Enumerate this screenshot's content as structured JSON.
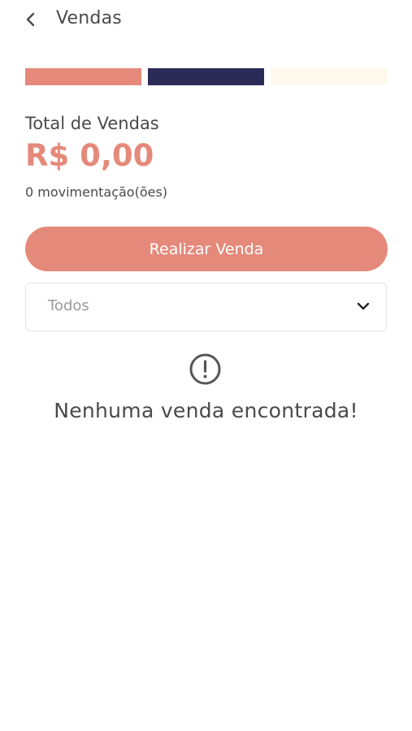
{
  "header": {
    "title": "Vendas",
    "back_icon": "chevron-left-icon"
  },
  "color_bars": {
    "colors": [
      "#e5897a",
      "#2c2b58",
      "#fdf9ec"
    ]
  },
  "summary": {
    "total_label": "Total de Vendas",
    "total_value": "R$ 0,00",
    "movements": "0 movimentação(ões)"
  },
  "actions": {
    "sell_button_label": "Realizar Venda"
  },
  "filter": {
    "selected": "Todos",
    "icon": "chevron-down-icon"
  },
  "empty_state": {
    "icon": "alert-circle-icon",
    "message": "Nenhuma venda encontrada!"
  },
  "colors": {
    "accent": "#e5897a",
    "dark": "#2c2b58",
    "cream": "#fdf9ec",
    "text": "#4a4a4a",
    "placeholder": "#9a9a9a"
  }
}
